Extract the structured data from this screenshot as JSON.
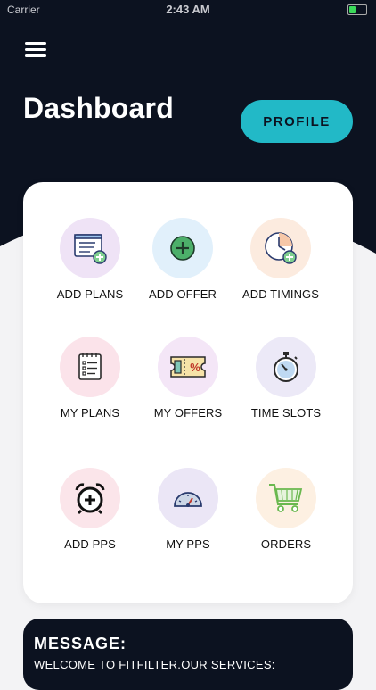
{
  "status_bar": {
    "carrier": "Carrier",
    "time": "2:43 AM"
  },
  "header": {
    "title": "Dashboard",
    "profile_label": "PROFILE"
  },
  "tiles": [
    {
      "label": "ADD PLANS",
      "icon": "add-plans-icon",
      "bg": "#efe3f6"
    },
    {
      "label": "ADD OFFER",
      "icon": "add-offer-icon",
      "bg": "#e1f0fb"
    },
    {
      "label": "ADD TIMINGS",
      "icon": "add-timings-icon",
      "bg": "#fcebdf"
    },
    {
      "label": "MY PLANS",
      "icon": "my-plans-icon",
      "bg": "#fbe3ea"
    },
    {
      "label": "MY OFFERS",
      "icon": "my-offers-icon",
      "bg": "#f4e6f7"
    },
    {
      "label": "TIME SLOTS",
      "icon": "time-slots-icon",
      "bg": "#ece9f7"
    },
    {
      "label": "ADD PPS",
      "icon": "alarm-clock-icon",
      "bg": "#fbe5ea"
    },
    {
      "label": "MY PPS",
      "icon": "gauge-icon",
      "bg": "#ebe6f6"
    },
    {
      "label": "ORDERS",
      "icon": "cart-icon",
      "bg": "#fdf0e2"
    }
  ],
  "message": {
    "heading": "MESSAGE:",
    "body": "WELCOME TO FITFILTER.OUR SERVICES:"
  },
  "colors": {
    "dark": "#0c1220",
    "accent": "#22b9c7",
    "white": "#ffffff"
  }
}
